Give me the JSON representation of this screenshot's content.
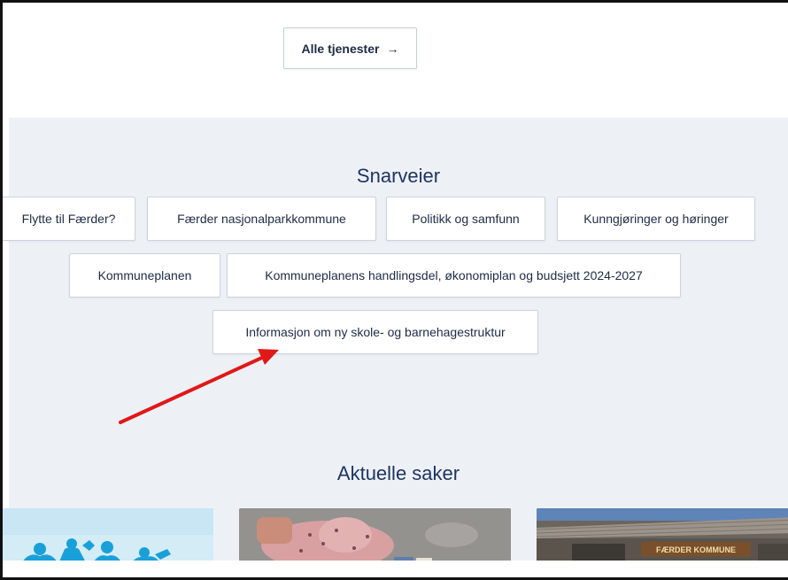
{
  "top": {
    "all_services_label": "Alle tjenester",
    "all_services_arrow": "→"
  },
  "shortcuts": {
    "title": "Snarveier",
    "items": [
      {
        "label": "Flytte til Færder?"
      },
      {
        "label": "Færder nasjonalparkkommune"
      },
      {
        "label": "Politikk og samfunn"
      },
      {
        "label": "Kunngjøringer og høringer"
      },
      {
        "label": "Kommuneplanen"
      },
      {
        "label": "Kommuneplanens handlingsdel, økonomiplan og budsjett 2024-2027"
      },
      {
        "label": "Informasjon om ny skole- og barnehagestruktur"
      }
    ]
  },
  "news": {
    "title": "Aktuelle saker",
    "cards": [
      {
        "image": "paper-chain-people-image"
      },
      {
        "image": "child-playing-image"
      },
      {
        "image": "town-hall-building-image",
        "sign_text": "FÆRDER KOMMUNE"
      }
    ]
  },
  "colors": {
    "section_bg": "#edf1f6",
    "heading": "#1f3461",
    "arrow": "#e01818"
  }
}
